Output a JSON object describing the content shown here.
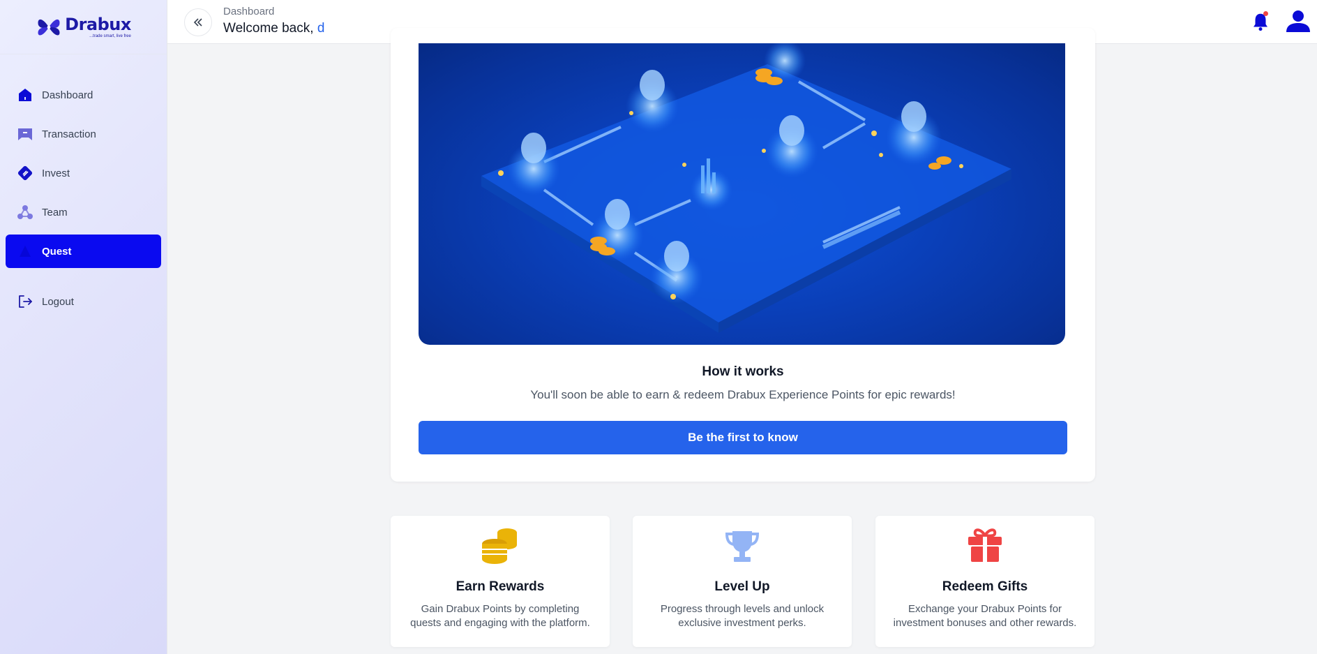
{
  "brand": {
    "name": "Drabux",
    "tagline": "...trade smart, live free"
  },
  "sidebar": {
    "items": [
      {
        "label": "Dashboard",
        "icon": "home-icon"
      },
      {
        "label": "Transaction",
        "icon": "receipt-icon"
      },
      {
        "label": "Invest",
        "icon": "invest-icon"
      },
      {
        "label": "Team",
        "icon": "team-icon"
      },
      {
        "label": "Quest",
        "icon": "quest-icon",
        "active": true
      }
    ],
    "logout_label": "Logout"
  },
  "header": {
    "breadcrumb": "Dashboard",
    "welcome_prefix": "Welcome back,",
    "username": "d",
    "has_notification": true
  },
  "main": {
    "how_title": "How it works",
    "how_desc": "You'll soon be able to earn & redeem Drabux Experience Points for epic rewards!",
    "cta_label": "Be the first to know"
  },
  "features": [
    {
      "title": "Earn Rewards",
      "desc": "Gain Drabux Points by completing quests and engaging with the platform.",
      "icon": "coins-icon",
      "color": "#eab308"
    },
    {
      "title": "Level Up",
      "desc": "Progress through levels and unlock exclusive investment perks.",
      "icon": "trophy-icon",
      "color": "#93b4f5"
    },
    {
      "title": "Redeem Gifts",
      "desc": "Exchange your Drabux Points for investment bonuses and other rewards.",
      "icon": "gift-icon",
      "color": "#ef4444"
    }
  ],
  "colors": {
    "accent": "#2563eb",
    "active_nav": "#0a0af0",
    "brand": "#1d1aa6"
  }
}
